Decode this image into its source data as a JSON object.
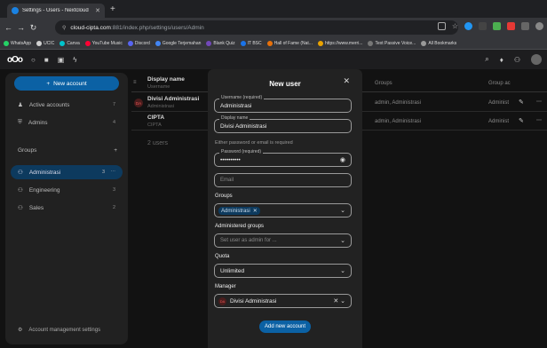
{
  "browser": {
    "tab_title": "Settings - Users - Nextcloud",
    "url_host": "cloud-cipta.com",
    "url_path": ":881/index.php/settings/users/Admin",
    "bookmarks": [
      {
        "label": "WhatsApp",
        "color": "#25d366"
      },
      {
        "label": "UCIC",
        "color": "#d0d0d0"
      },
      {
        "label": "Canva",
        "color": "#00c4cc"
      },
      {
        "label": "YouTube Music",
        "color": "#ff0033"
      },
      {
        "label": "Discord",
        "color": "#5865f2"
      },
      {
        "label": "Google Terjemahan",
        "color": "#4285f4"
      },
      {
        "label": "Blank Quiz",
        "color": "#7248b9"
      },
      {
        "label": "IT BSC",
        "color": "#1a73e8"
      },
      {
        "label": "Hall of Fame (Nat...",
        "color": "#e8710a"
      },
      {
        "label": "https://www.merri...",
        "color": "#eaa300"
      },
      {
        "label": "Text Passive Voice...",
        "color": "#777"
      },
      {
        "label": "All Bookmarks",
        "color": "#999"
      }
    ]
  },
  "sidebar": {
    "new_account": "New account",
    "items": [
      {
        "label": "Active accounts",
        "count": "7",
        "icon": "person-icon"
      },
      {
        "label": "Admins",
        "count": "4",
        "icon": "shield-icon"
      }
    ],
    "groups_label": "Groups",
    "groups": [
      {
        "label": "Administrasi",
        "count": "3",
        "active": true
      },
      {
        "label": "Engineering",
        "count": "3"
      },
      {
        "label": "Sales",
        "count": "2"
      }
    ],
    "account_settings": "Account management settings"
  },
  "table": {
    "headers": {
      "display_name": "Display name",
      "username": "Username",
      "groups": "Groups",
      "group_admin": "Group ac"
    },
    "rows": [
      {
        "avatar": "DA",
        "display_name": "Divisi Administrasi",
        "username": "Administrasi",
        "groups": "admin, Administrasi",
        "group_admin": "Administ"
      },
      {
        "avatar": "",
        "display_name": "CIPTA",
        "username": "CIPTA",
        "groups": "admin, Administrasi",
        "group_admin": "Administ"
      }
    ],
    "count_text": "2 users"
  },
  "modal": {
    "title": "New user",
    "username_label": "Username (required)",
    "username_value": "Administrasi",
    "displayname_label": "Display name",
    "displayname_value": "Divisi Administrasi",
    "hint": "Either password or email is required",
    "password_label": "Password (required)",
    "password_value": "••••••••••",
    "email_placeholder": "Email",
    "groups_label": "Groups",
    "group_chip": "Administrasi",
    "admin_groups_label": "Administered groups",
    "admin_groups_placeholder": "Set user as admin for ...",
    "quota_label": "Quota",
    "quota_value": "Unlimited",
    "manager_label": "Manager",
    "manager_avatar": "DA",
    "manager_value": "Divisi Administrasi",
    "add_button": "Add new account"
  }
}
